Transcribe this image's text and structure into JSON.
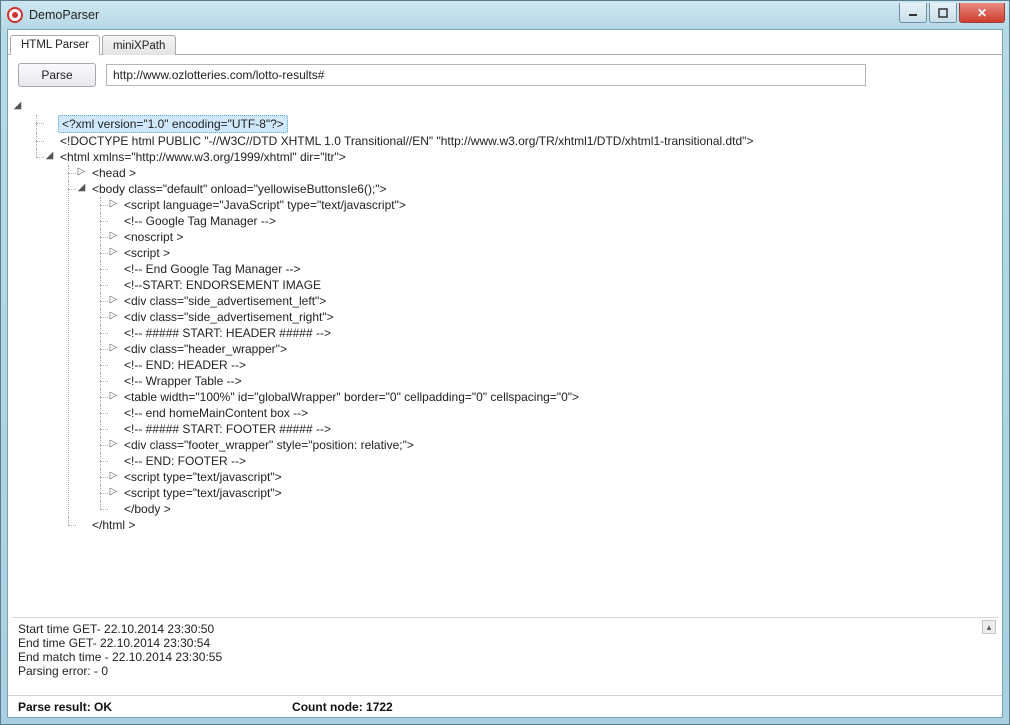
{
  "titlebar": {
    "title": "DemoParser"
  },
  "tabs": {
    "parser": "HTML Parser",
    "xpath": "miniXPath"
  },
  "toolbar": {
    "parse_label": "Parse",
    "url_value": "http://www.ozlotteries.com/lotto-results#"
  },
  "tree": {
    "xml_decl": "<?xml version=\"1.0\" encoding=\"UTF-8\"?>",
    "doctype": "<!DOCTYPE html PUBLIC \"-//W3C//DTD XHTML 1.0 Transitional//EN\" \"http://www.w3.org/TR/xhtml1/DTD/xhtml1-transitional.dtd\">",
    "html_open": "<html xmlns=\"http://www.w3.org/1999/xhtml\" dir=\"ltr\">",
    "head": "<head >",
    "body_open": "<body class=\"default\"  onload=\"yellowiseButtonsIe6();\">",
    "body_children": [
      {
        "t": "<script language=\"JavaScript\" type=\"text/javascript\">",
        "exp": true
      },
      {
        "t": "<!-- Google Tag Manager -->",
        "exp": false
      },
      {
        "t": "<noscript >",
        "exp": true
      },
      {
        "t": "<script >",
        "exp": true
      },
      {
        "t": "<!-- End Google Tag Manager -->",
        "exp": false
      },
      {
        "t": "<!--START: ENDORSEMENT IMAGE",
        "exp": false
      },
      {
        "t": "<div class=\"side_advertisement_left\">",
        "exp": true
      },
      {
        "t": "<div class=\"side_advertisement_right\">",
        "exp": true
      },
      {
        "t": "<!-- ##### START: HEADER ##### -->",
        "exp": false
      },
      {
        "t": "<div class=\"header_wrapper\">",
        "exp": true
      },
      {
        "t": "<!-- END: HEADER -->",
        "exp": false
      },
      {
        "t": "<!-- Wrapper Table -->",
        "exp": false
      },
      {
        "t": "<table width=\"100%\" id=\"globalWrapper\" border=\"0\" cellpadding=\"0\" cellspacing=\"0\">",
        "exp": true
      },
      {
        "t": "<!-- end homeMainContent box -->",
        "exp": false
      },
      {
        "t": "<!--  ##### START: FOOTER ##### -->",
        "exp": false
      },
      {
        "t": "<div class=\"footer_wrapper\" style=\"position: relative;\">",
        "exp": true
      },
      {
        "t": "<!-- END: FOOTER -->",
        "exp": false
      },
      {
        "t": "<script type=\"text/javascript\">",
        "exp": true
      },
      {
        "t": "<script type=\"text/javascript\">",
        "exp": true
      },
      {
        "t": " </body >",
        "exp": false
      }
    ],
    "html_close": "</html >"
  },
  "log": {
    "l1": "Start time GET- 22.10.2014 23:30:50",
    "l2": "End time GET- 22.10.2014 23:30:54",
    "l3": "End match time - 22.10.2014 23:30:55",
    "l4": "Parsing error: - 0"
  },
  "status": {
    "result": "Parse result: OK",
    "count": "Count node: 1722"
  },
  "glyph": {
    "collapsed": "▷",
    "expanded": "◢"
  }
}
